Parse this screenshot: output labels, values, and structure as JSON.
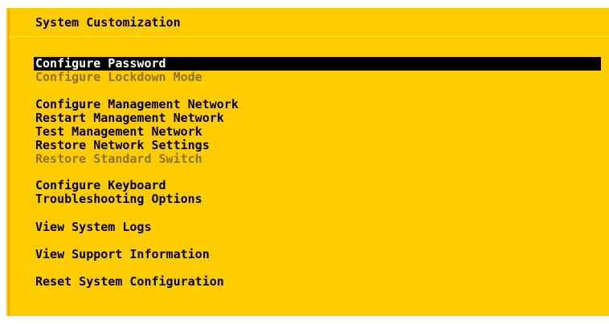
{
  "screen": {
    "title": "System Customization",
    "colors": {
      "background": "#ffcc00",
      "text": "#000000",
      "disabled_text": "#8c7320",
      "selected_background": "#000000",
      "selected_text": "#ffffff"
    }
  },
  "menu": {
    "groups": [
      {
        "items": [
          {
            "label": "Configure Password",
            "selected": true,
            "disabled": false
          },
          {
            "label": "Configure Lockdown Mode",
            "selected": false,
            "disabled": true
          }
        ]
      },
      {
        "items": [
          {
            "label": "Configure Management Network",
            "selected": false,
            "disabled": false
          },
          {
            "label": "Restart Management Network",
            "selected": false,
            "disabled": false
          },
          {
            "label": "Test Management Network",
            "selected": false,
            "disabled": false
          },
          {
            "label": "Restore Network Settings",
            "selected": false,
            "disabled": false
          },
          {
            "label": "Restore Standard Switch",
            "selected": false,
            "disabled": true
          }
        ]
      },
      {
        "items": [
          {
            "label": "Configure Keyboard",
            "selected": false,
            "disabled": false
          },
          {
            "label": "Troubleshooting Options",
            "selected": false,
            "disabled": false
          }
        ]
      },
      {
        "items": [
          {
            "label": "View System Logs",
            "selected": false,
            "disabled": false
          }
        ]
      },
      {
        "items": [
          {
            "label": "View Support Information",
            "selected": false,
            "disabled": false
          }
        ]
      },
      {
        "items": [
          {
            "label": "Reset System Configuration",
            "selected": false,
            "disabled": false
          }
        ]
      }
    ]
  }
}
